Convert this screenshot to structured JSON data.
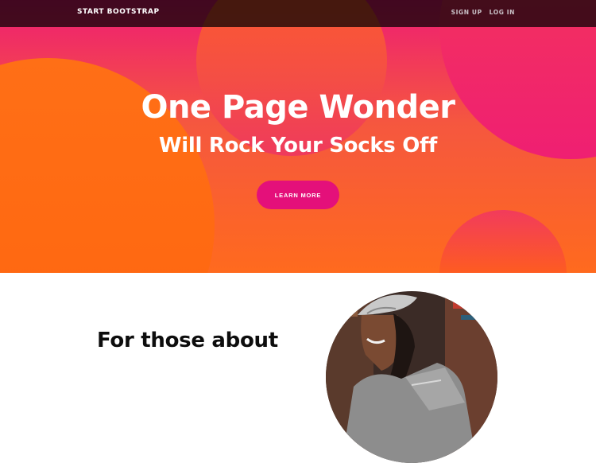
{
  "navbar": {
    "brand": "START BOOTSTRAP",
    "links": [
      "SIGN UP",
      "LOG IN"
    ]
  },
  "hero": {
    "headline": "One Page Wonder",
    "subheadline": "Will Rock Your Socks Off",
    "cta_label": "LEARN MORE"
  },
  "section": {
    "heading": "For those about"
  },
  "colors": {
    "hero_pink": "#ee1c74",
    "hero_orange": "#ff6a1e",
    "button": "#e4107a",
    "navbar": "#2a0a14"
  }
}
